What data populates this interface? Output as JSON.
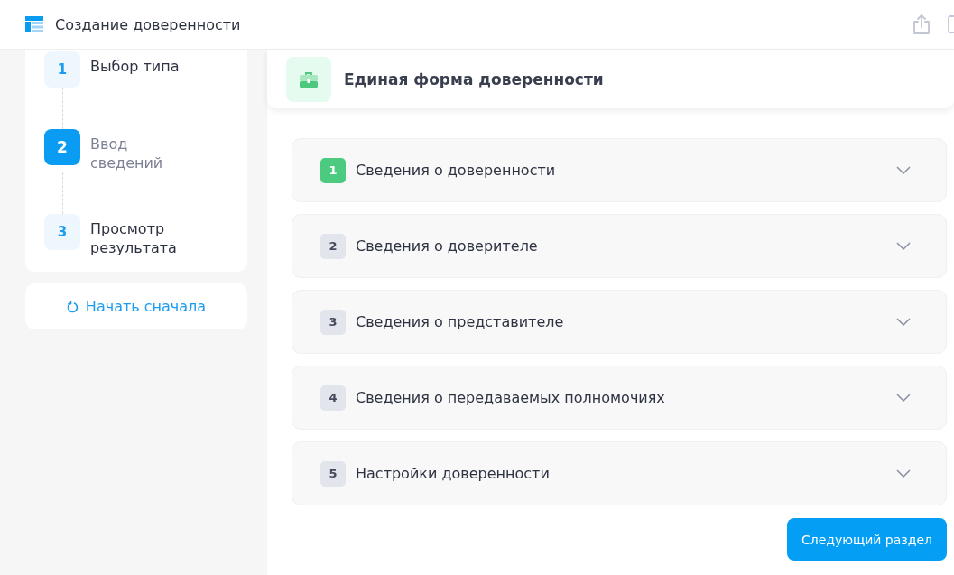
{
  "header": {
    "title": "Создание доверенности"
  },
  "steps": [
    {
      "number": "1",
      "label": "Выбор типа",
      "selected": false
    },
    {
      "number": "2",
      "label": "Ввод сведений",
      "selected": true
    },
    {
      "number": "3",
      "label": "Просмотр результата",
      "selected": false
    }
  ],
  "restart_button": {
    "label": "Начать сначала"
  },
  "form": {
    "title": "Единая форма доверенности"
  },
  "sections": [
    {
      "number": "1",
      "title": "Сведения о доверенности",
      "done": true,
      "expanded": false
    },
    {
      "number": "2",
      "title": "Сведения о доверителе",
      "done": false,
      "expanded": false
    },
    {
      "number": "3",
      "title": "Сведения о представителе",
      "done": false,
      "expanded": false
    },
    {
      "number": "4",
      "title": "Сведения о передаваемых полномочиях",
      "done": false,
      "expanded": false
    },
    {
      "number": "5",
      "title": "Настройки доверенности",
      "done": false,
      "expanded": false
    }
  ],
  "next_button": {
    "label": "Следующий раздел"
  }
}
